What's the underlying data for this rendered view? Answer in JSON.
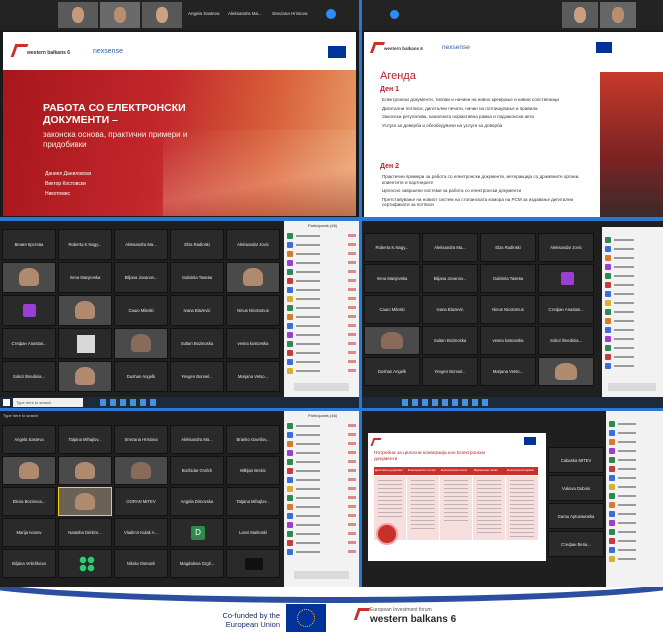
{
  "top_left": {
    "participants": [
      "Angela Sasteva",
      "Aleksandra Ma...",
      "Snezana Hristova"
    ],
    "logo_text": "western balkans 6",
    "partner_text": "nexsense",
    "slide_title": "РАБОТА СО ЕЛЕКТРОНСКИ ДОКУМЕНТИ –",
    "slide_subtitle": "законска основа, практични примери и придобивки",
    "presenters": [
      "Даниел Даниловски",
      "Виктор Костовски",
      "Никотомис"
    ]
  },
  "top_right": {
    "logo_text": "western balkans 6",
    "partner_text": "nexsense",
    "agenda_title": "Агенда",
    "day1": "Ден 1",
    "day1_items": [
      "Електронски документи, типови и начини на нивно креирање и нивни сопственици",
      "Дигитални потписи, дигитални печати, начин на потпишување и правила",
      "Законска регулатива, каналната нормативна рамка и подзаконски акти",
      "Услуги за доверба и обезбедувачи на услуги за доверба"
    ],
    "day2": "Ден 2",
    "day2_items": [
      "Практични примери за работа со електронски документи, интеракција со државните органи, клиентите и партнерите",
      "Целосно завршени системи за работа со електронски документи",
      "Претставување на новиот систем на стопанската комора на РСМ за издавање дигитални сертификати за потписи"
    ]
  },
  "mid_left": {
    "rows": [
      [
        "Вения Крстева",
        "Roberta K.Nagy...",
        "Aleksandra Ma...",
        "Elza Radinski",
        "Aleksandar Jovic"
      ],
      [
        "",
        "Irena Manjevska",
        "Biljana Jovanov...",
        "Gabriela Tasева",
        ""
      ],
      [
        "",
        "",
        "Сашо Mileski",
        "Ivana Blazevic",
        "Ninus Nicotomus"
      ],
      [
        "Стефан Anastas...",
        "",
        "",
        "Sultan Bozinoska",
        "vesna kostovska"
      ],
      [
        "Sokol Ilmedinia...",
        "",
        "Dushan Angelk",
        "Yevgen Bonnel...",
        "Marjana Vetso..."
      ]
    ],
    "sidebar_title": "Participants (46)",
    "taskbar_search": "Type here to search"
  },
  "mid_right": {
    "rows": [
      [
        "Roberta K.Nagy...",
        "Aleksandra Ma...",
        "Elza Radinski",
        "Aleksandar Jovic"
      ],
      [
        "Irena Manjevska",
        "Biljana Jovanov...",
        "Gabriela Tasева",
        ""
      ],
      [
        "Сашо Mileski",
        "Ivana Blazevic",
        "Ninus Nicotomus",
        "Стефан Anastas..."
      ],
      [
        "",
        "Sultan Bozinoska",
        "vesna kostovska",
        "Sokol Ilmedinia..."
      ],
      [
        "Dushan Angelk",
        "Yevgen Bonnel...",
        "Marjana Vetso...",
        ""
      ]
    ]
  },
  "bottom_left": {
    "rows": [
      [
        "Angela Sasteva",
        "Tatjana Mihajlov...",
        "Snezana Hristova",
        "Aleksandra Ma...",
        "Branko Gavrilov..."
      ],
      [
        "",
        "",
        "",
        "Bozhidar Grafch",
        "Miltijan Brekic"
      ],
      [
        "Elena Bozinova...",
        "",
        "GORAN MITEV",
        "Angela Dimovska",
        "Tatjana Mihajlov..."
      ],
      [
        "Marija Ivanov",
        "Natasha Dimitro...",
        "Vladimir Kulak A...",
        "",
        "Lanvi Markoski"
      ],
      [
        "Biljana Velichkova",
        "",
        "Nikola Osmanli",
        "Magdalena Grgil...",
        ""
      ]
    ],
    "avatar_letter": "D",
    "sidebar_title": "Participants (46)",
    "taskbar_search": "Type here to search"
  },
  "bottom_right": {
    "slide_title": "Потребна за целосна конверзија кон Електронски документи",
    "table_headers": [
      "Дигитален документ",
      "Електронски потпис",
      "Електронски печат",
      "Временски печат",
      "Електронски архив"
    ],
    "side_names": [
      "Cabaska MITEV",
      "Vukova Dubois",
      "Garou Apturawoska",
      "Стефан Beria..."
    ]
  },
  "footer": {
    "cofunded": "Co-funded by the European Union",
    "forum_small": "European Investment forum",
    "forum_big": "western balkans 6"
  },
  "colors": {
    "slide_red": "#b81e23",
    "eu_blue": "#003399",
    "eu_yellow": "#ffcc00",
    "divider": "#2b78d4"
  }
}
